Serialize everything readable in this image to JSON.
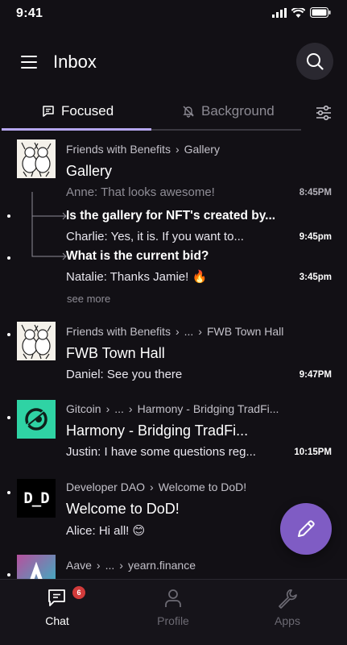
{
  "status_bar": {
    "time": "9:41"
  },
  "header": {
    "title": "Inbox"
  },
  "tabs": {
    "focused": "Focused",
    "background": "Background"
  },
  "threads": [
    {
      "breadcrumb": [
        "Friends with Benefits",
        "Gallery"
      ],
      "title": "Gallery",
      "preview": "Anne: That looks awesome!",
      "timestamp": "8:45PM",
      "replies": [
        {
          "title": "Is the gallery for NFT's created by...",
          "message": "Charlie: Yes, it is. If you want to...",
          "timestamp": "9:45pm"
        },
        {
          "title": "What is the current bid?",
          "message": "Natalie: Thanks Jamie! 🔥",
          "timestamp": "3:45pm"
        }
      ],
      "see_more": "see more"
    },
    {
      "breadcrumb": [
        "Friends with Benefits",
        "...",
        "FWB Town Hall"
      ],
      "title": "FWB Town Hall",
      "preview": "Daniel: See you there",
      "timestamp": "9:47PM"
    },
    {
      "breadcrumb": [
        "Gitcoin",
        "...",
        "Harmony - Bridging TradFi..."
      ],
      "title": "Harmony - Bridging TradFi...",
      "preview": "Justin: I have some questions reg...",
      "timestamp": "10:15PM"
    },
    {
      "breadcrumb": [
        "Developer DAO",
        "Welcome to DoD!"
      ],
      "title": "Welcome to DoD!",
      "preview": "Alice: Hi all! 😊",
      "avatar_text": "D_D"
    },
    {
      "breadcrumb": [
        "Aave",
        "...",
        "yearn.finance"
      ]
    }
  ],
  "bottom_nav": {
    "chat": "Chat",
    "chat_badge": "6",
    "profile": "Profile",
    "apps": "Apps"
  },
  "colors": {
    "background": "#121015",
    "accent": "#b6a7f0",
    "fab": "#7f5cc4",
    "gitcoin": "#2fd3a4",
    "badge": "#d23b3b"
  },
  "icons": [
    "menu-icon",
    "search-icon",
    "chat-bubble-icon",
    "bell-off-icon",
    "filter-sliders-icon",
    "pencil-icon",
    "person-icon",
    "wrench-icon"
  ]
}
